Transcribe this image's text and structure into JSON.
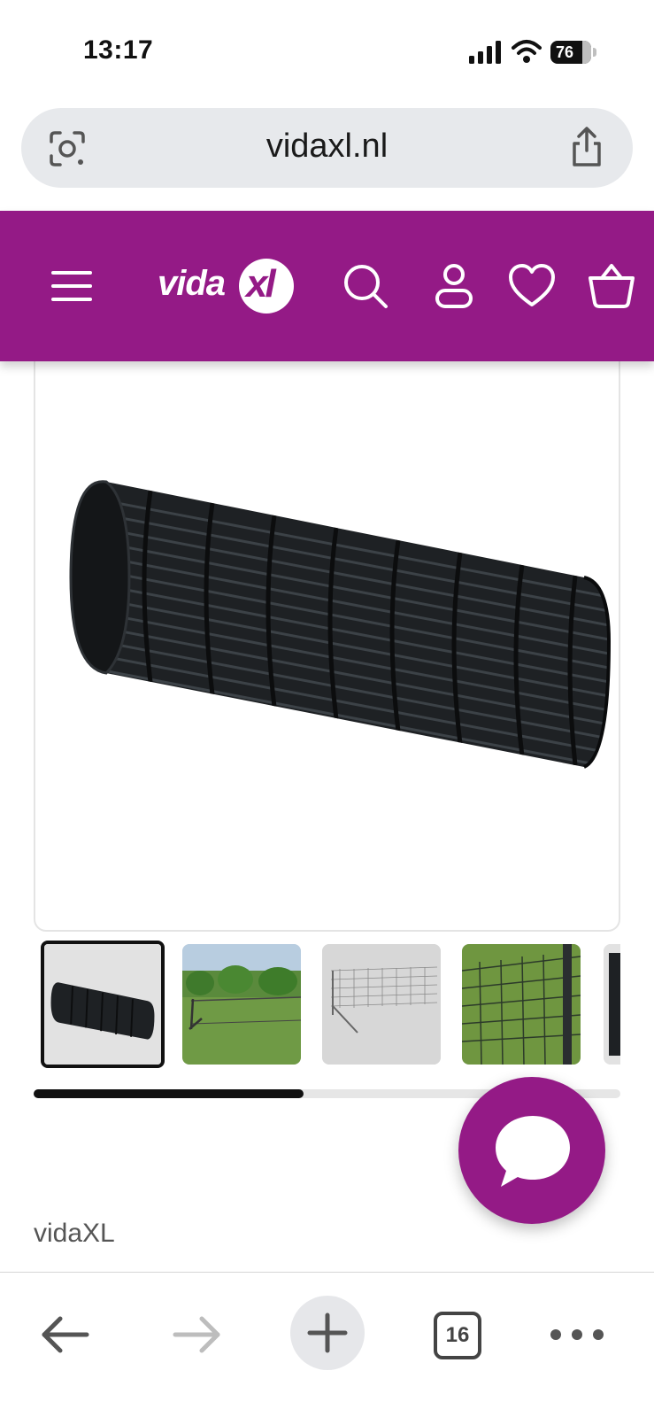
{
  "status_bar": {
    "time": "13:17",
    "battery": "76"
  },
  "browser": {
    "url": "vidaxl.nl",
    "open_tabs": "16"
  },
  "header": {
    "logo_text": "vida",
    "logo_xl": "xl",
    "brand_color": "#941a86"
  },
  "gallery": {
    "thumbnails": [
      "product-roll",
      "fence-in-field",
      "fence-on-white",
      "fence-closeup",
      "product-partial"
    ],
    "active_index": 0,
    "scroll_position": 0.46
  },
  "brand_label": "vidaXL",
  "icons": [
    "camera-lens-icon",
    "share-icon",
    "menu-icon",
    "search-icon",
    "account-icon",
    "heart-icon",
    "basket-icon",
    "chat-icon",
    "back-arrow-icon",
    "forward-arrow-icon",
    "plus-icon",
    "more-icon"
  ]
}
